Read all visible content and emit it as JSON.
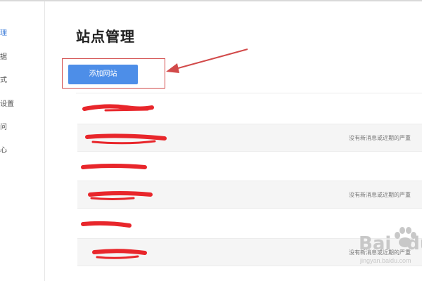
{
  "sidebar": {
    "items": [
      {
        "label": "理",
        "active": true
      },
      {
        "label": "据",
        "active": false
      },
      {
        "label": "式",
        "active": false
      },
      {
        "label": "设置",
        "active": false
      },
      {
        "label": "问",
        "active": false
      },
      {
        "label": "心",
        "active": false
      }
    ]
  },
  "main": {
    "title": "站点管理",
    "add_button_label": "添加网站",
    "rows": [
      {
        "status": ""
      },
      {
        "status": "没有新消息或近期的严重"
      },
      {
        "status": ""
      },
      {
        "status": "没有新消息或近期的严重"
      },
      {
        "status": ""
      },
      {
        "status": "没有新消息或近期的严重"
      }
    ]
  },
  "annotation": {
    "color": "#d24a4a"
  },
  "watermark": {
    "text": "Bai",
    "paw": "paw-icon",
    "text2": "du",
    "sub": "jingyan.baidu.com"
  },
  "colors": {
    "accent": "#4d8ee8",
    "redaction": "#e8262b"
  }
}
